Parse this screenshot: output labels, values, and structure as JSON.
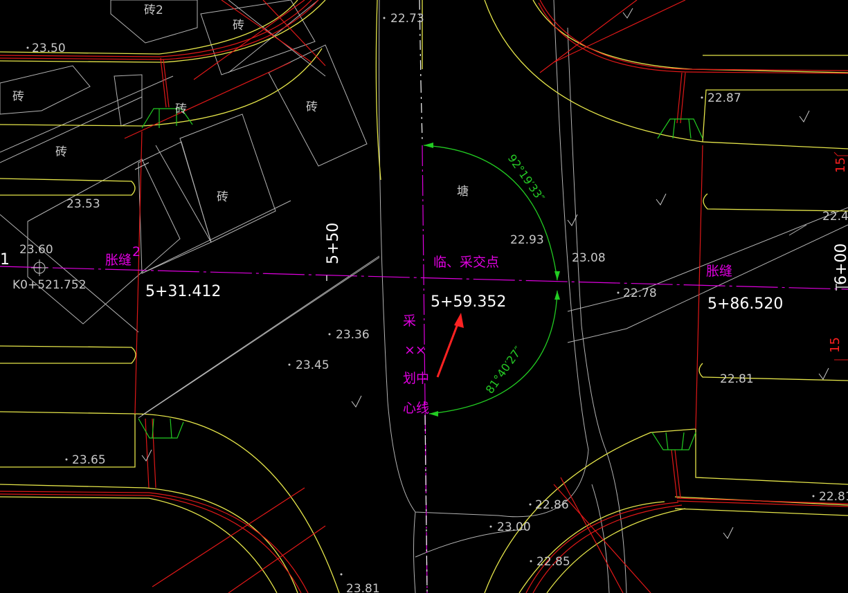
{
  "drawing": {
    "background": "#000000",
    "colors": {
      "curb": "#e6e64a",
      "boundary": "#e01818",
      "centerline": "#e000e0",
      "building": "#b4b4b4",
      "dimension": "#22cc22",
      "label_white": "#ffffff",
      "label_grey": "#c8c8c8",
      "arrow": "#ff2222"
    },
    "stations": {
      "left": "5+31.412",
      "center": "5+59.352",
      "right": "5+86.520",
      "kp": "K0+521.752",
      "tick_550": "5+50",
      "tick_600": "6+00",
      "left_partial": "1"
    },
    "annotations": {
      "expansion_joint_left": "胀缝",
      "expansion_joint_right": "胀缝",
      "intersection": "临、采交点",
      "centerline_1": "采",
      "centerline_2": "××",
      "centerline_3": "划中",
      "centerline_4": "心线",
      "pond": "塘",
      "small_2": "2"
    },
    "bricks": [
      "砖2",
      "砖",
      "砖",
      "砖",
      "砖",
      "砖",
      "砖"
    ],
    "angles": {
      "upper": "92°19′33″",
      "lower": "81°40′27″"
    },
    "elevations": {
      "e1": "22.73",
      "e2": "23.50",
      "e3": "23.53",
      "e4": "23.60",
      "e5": "22.93",
      "e6": "23.08",
      "e7": "22.78",
      "e8": "23.36",
      "e9": "23.45",
      "e10": "23.65",
      "e11": "22.87",
      "e12": "22.4",
      "e13": "22.81",
      "e14": "22.86",
      "e15": "23.00",
      "e16": "22.85",
      "e17": "22.81",
      "e18": "23.81"
    },
    "side_marks": {
      "r1": "15",
      "r2": "15"
    }
  }
}
